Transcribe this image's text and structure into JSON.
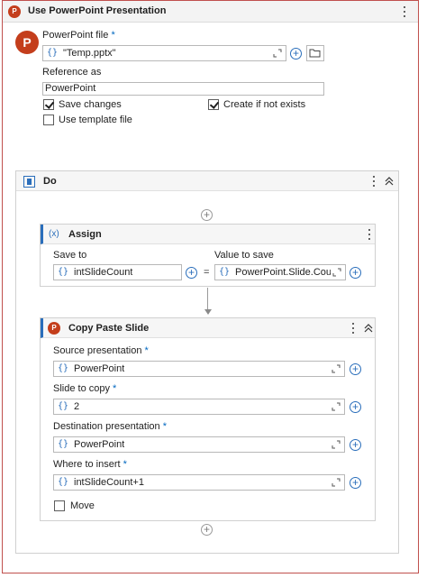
{
  "activity": {
    "title": "Use PowerPoint Presentation",
    "icon_letter": "P",
    "file_label": "PowerPoint file",
    "required_mark": "*",
    "file_value": "\"Temp.pptx\"",
    "reference_label": "Reference as",
    "reference_value": "PowerPoint",
    "save_changes_label": "Save changes",
    "save_changes": true,
    "create_if_not_exists_label": "Create if not exists",
    "create_if_not_exists": true,
    "use_template_label": "Use template file",
    "use_template": false
  },
  "do_block": {
    "title": "Do"
  },
  "assign": {
    "title": "Assign",
    "icon_text": "(x)",
    "save_to_label": "Save to",
    "save_to_value": "intSlideCount",
    "equals": "=",
    "value_label": "Value to save",
    "value_value": "PowerPoint.Slide.Count"
  },
  "copy_paste": {
    "title": "Copy Paste Slide",
    "icon_letter": "P",
    "source_label": "Source presentation",
    "source_value": "PowerPoint",
    "slide_label": "Slide to copy",
    "slide_value": "2",
    "dest_label": "Destination presentation",
    "dest_value": "PowerPoint",
    "where_label": "Where to insert",
    "where_value": "intSlideCount+1",
    "move_label": "Move",
    "move": false
  },
  "common": {
    "expr_brace": "{}",
    "plus": "+"
  },
  "colors": {
    "frame_border": "#c0504d",
    "powerpoint_brand": "#c43e1c",
    "accent_blue": "#2a6ebb",
    "required_blue": "#0067c0"
  }
}
